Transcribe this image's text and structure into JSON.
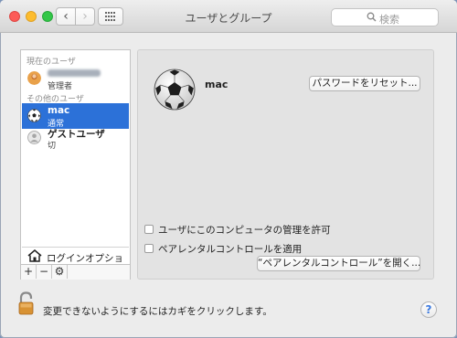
{
  "window": {
    "title": "ユーザとグループ"
  },
  "toolbar": {
    "back": "‹",
    "forward": "›"
  },
  "search": {
    "placeholder": "検索"
  },
  "sidebar": {
    "current_users_label": "現在のユーザ",
    "current_user": {
      "name": "",
      "role": "管理者"
    },
    "other_users_label": "その他のユーザ",
    "other_users": [
      {
        "name": "mac",
        "role": "通常",
        "avatar": "soccer-ball",
        "selected": true
      },
      {
        "name": "ゲストユーザ",
        "role": "切",
        "avatar": "guest-silhouette",
        "selected": false
      }
    ],
    "login_options_label": "ログインオプション",
    "add_label": "+",
    "remove_label": "−",
    "action_label": "⚙"
  },
  "detail": {
    "user_name": "mac",
    "reset_password_label": "パスワードをリセット...",
    "allow_admin_label": "ユーザにこのコンピュータの管理を許可",
    "parental_controls_label": "ペアレンタルコントロールを適用",
    "open_parental_controls_label": "“ペアレンタルコントロール”を開く..."
  },
  "footer": {
    "lock_text": "変更できないようにするにはカギをクリックします。",
    "help_label": "?"
  }
}
